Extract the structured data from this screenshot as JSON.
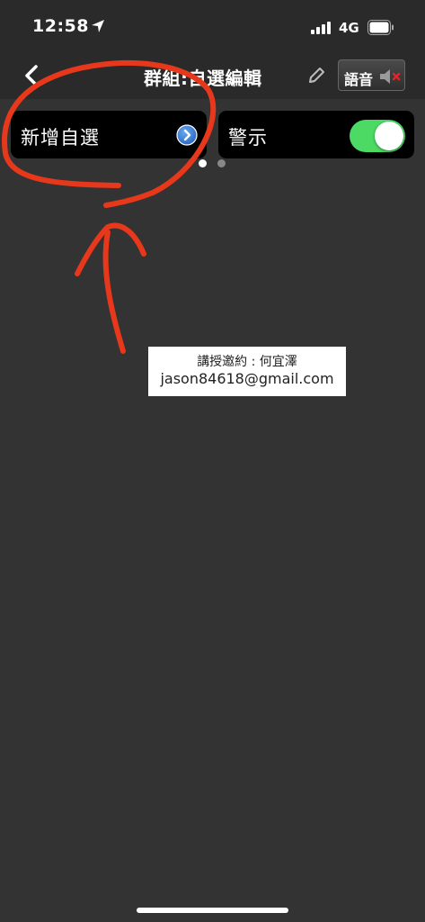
{
  "status_bar": {
    "time": "12:58",
    "network": "4G",
    "location_icon": "location-arrow-icon",
    "signal_icon": "cellular-signal-icon",
    "battery_icon": "battery-icon"
  },
  "nav": {
    "back_icon": "chevron-left-icon",
    "title": "群組:自選編輯",
    "edit_icon": "pencil-icon",
    "voice_label": "語音",
    "mute_icon": "speaker-muted-icon"
  },
  "cards": {
    "add_label": "新增自選",
    "add_icon": "chevron-right-circle-icon",
    "alert_label": "警示",
    "alert_toggle_on": true
  },
  "pager": {
    "current": 1,
    "total": 2
  },
  "contact": {
    "line1": "講授邀約 : 何宜澤",
    "line2": "jason84618@gmail.com"
  },
  "colors": {
    "background": "#333333",
    "bar": "#2a2a2a",
    "card": "#000000",
    "toggle_on": "#4cd964",
    "chevron_blue": "#3a7fd9",
    "annotation_red": "#e8381c"
  }
}
